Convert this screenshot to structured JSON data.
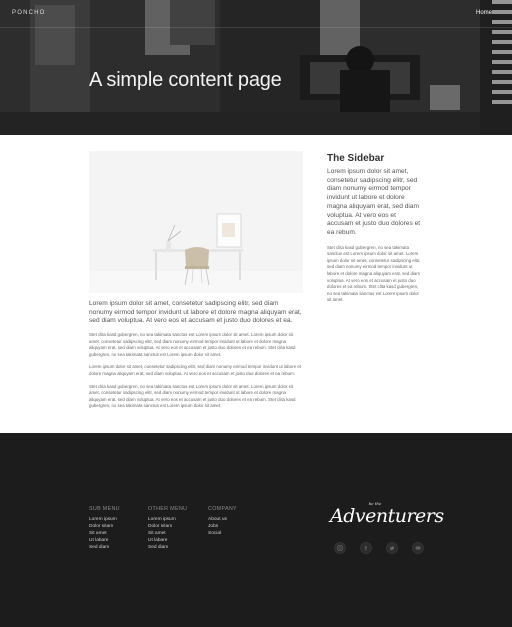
{
  "header": {
    "brand": "PONCHO",
    "nav_home": "Home",
    "title": "A simple content page"
  },
  "main": {
    "lead": "Lorem ipsum dolor sit amet, consetetur sadipscing elitr, sed diam nonumy eirmod tempor invidunt ut labore et dolore magna aliquyam erat, sed diam voluptua. At vero eos et accusam et justo duo dolores et ea.",
    "paragraphs": [
      "Stet clita kasd gubergren, no sea takimata sanctus est Lorem ipsum dolor sit amet. Lorem ipsum dolor sit amet, consetetur sadipscing elitr, sed diam nonumy eirmod tempor invidunt ut labore et dolore magna aliquyam erat, sed diam voluptua. At vero eos et accusam et justo duo dolores et ea rebum. Stet clita kasd gubergren, no sea takimata sanctus est Lorem ipsum dolor sit amet.",
      "Lorem ipsum dolor sit amet, consetetur sadipscing elitr, sed diam nonumy eirmod tempor invidunt ut labore et dolore magna aliquyam erat, sed diam voluptua. At vero eos et accusam et justo duo dolores et ea rebum.",
      "Stet clita kasd gubergren, no sea takimata sanctus est Lorem ipsum dolor sit amet. Lorem ipsum dolor sit amet, consetetur sadipscing elitr, sed diam nonumy eirmod tempor invidunt ut labore et dolore magna aliquyam erat, sed diam voluptua. At vero eos et accusam et justo duo dolores et ea rebum. Stet clita kasd gubergren, no sea takimata sanctus est Lorem ipsum dolor sit amet."
    ]
  },
  "sidebar": {
    "title": "The Sidebar",
    "lead": "Lorem ipsum dolor sit amet, consetetur sadipscing elitr, sed diam nonumy eirmod tempor invidunt ut labore et dolore magna aliquyam erat, sed diam voluptua. At vero eos et accusam et justo duo dolores et ea rebum.",
    "small": "Stet clita kasd gubergren, no sea takimata sanctus est Lorem ipsum dolor sit amet. Lorem ipsum dolor sit amet, consetetur sadipscing elitr, sed diam nonumy eirmod tempor invidunt ut labore et dolore magna aliquyam erat, sed diam voluptua. At vero eos et accusam et justo duo dolores et ea rebum. Stet clita kasd gubergren, no sea takimata sanctus est Lorem ipsum dolor sit amet."
  },
  "footer": {
    "columns": [
      {
        "title": "SUB MENU",
        "links": [
          "Lorem ipsum",
          "Dolor sitam",
          "Sit amet",
          "Ut labare",
          "Sed diam"
        ]
      },
      {
        "title": "OTHER MENU",
        "links": [
          "Lorem ipsum",
          "Dolor sitam",
          "Sit amet",
          "Ut labare",
          "Sed diam"
        ]
      },
      {
        "title": "COMPANY",
        "links": [
          "About us",
          "Jobs",
          "Social"
        ]
      }
    ],
    "logo_small": "be the",
    "logo": "Adventurers",
    "social_icons": [
      "instagram-icon",
      "facebook-icon",
      "twitter-icon",
      "youtube-icon"
    ]
  },
  "colors": {
    "footer_bg": "#1c1c1c",
    "hero_overlay": "#2a2a2a",
    "text": "#555555"
  }
}
